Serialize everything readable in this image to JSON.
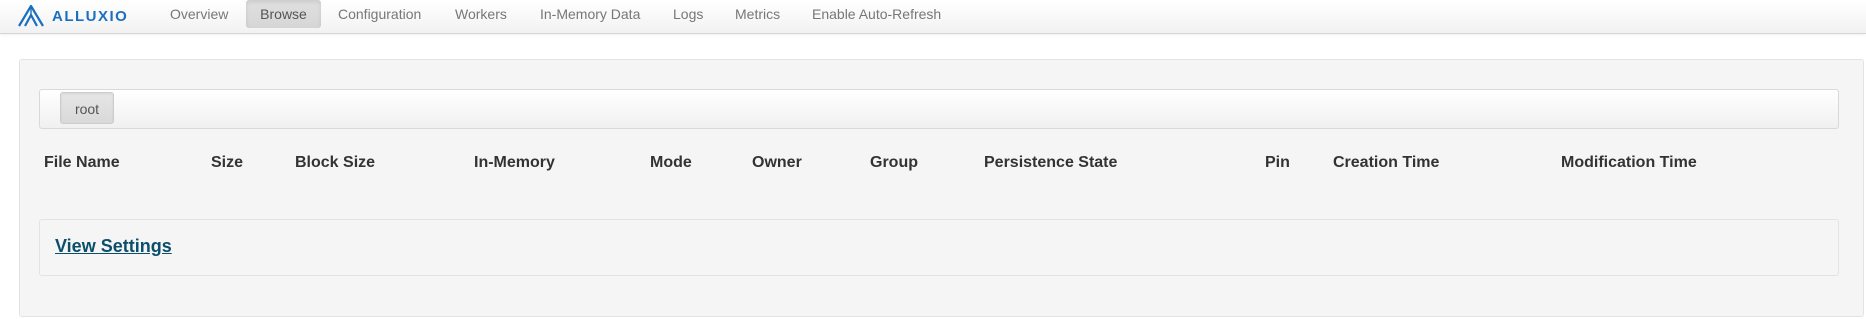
{
  "brand": {
    "name": "ALLUXIO",
    "color": "#1b6fc1"
  },
  "nav": {
    "items": [
      {
        "label": "Overview",
        "active": false
      },
      {
        "label": "Browse",
        "active": true
      },
      {
        "label": "Configuration",
        "active": false
      },
      {
        "label": "Workers",
        "active": false
      },
      {
        "label": "In-Memory Data",
        "active": false
      },
      {
        "label": "Logs",
        "active": false
      },
      {
        "label": "Metrics",
        "active": false
      },
      {
        "label": "Enable Auto-Refresh",
        "active": false
      }
    ]
  },
  "breadcrumb": {
    "root_label": "root"
  },
  "table": {
    "columns": [
      "File Name",
      "Size",
      "Block Size",
      "In-Memory",
      "Mode",
      "Owner",
      "Group",
      "Persistence State",
      "Pin",
      "Creation Time",
      "Modification Time"
    ],
    "rows": []
  },
  "settings": {
    "link_label": "View Settings",
    "link_color": "#0b4f6c"
  }
}
